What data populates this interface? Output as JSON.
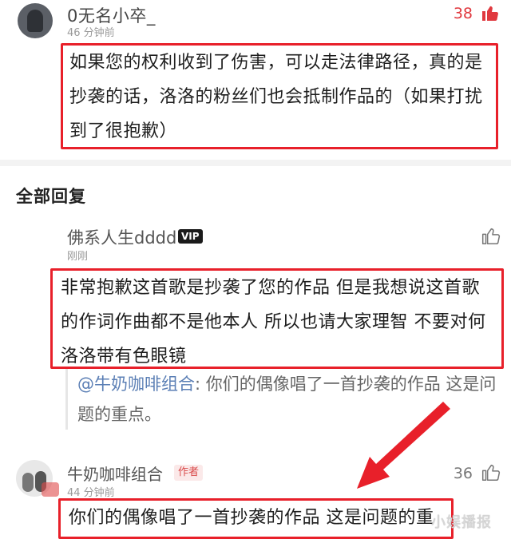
{
  "comment1": {
    "username": "0无名小卒_",
    "time": "46 分钟前",
    "likes": "38",
    "text": "如果您的权利收到了伤害，可以走法律路径，真的是抄袭的话，洛洛的粉丝们也会抵制作品的（如果打扰到了很抱歉）"
  },
  "section": {
    "title": "全部回复"
  },
  "comment2": {
    "username": "佛系人生dddd",
    "badge": "VIP",
    "time": "刚刚",
    "text": "非常抱歉这首歌是抄袭了您的作品 但是我想说这首歌的作词作曲都不是他本人 所以也请大家理智 不要对何洛洛带有色眼镜"
  },
  "quote": {
    "mention": "@牛奶咖啡组合",
    "text": ": 你们的偶像唱了一首抄袭的作品 这是问题的重点。"
  },
  "comment3": {
    "username": "牛奶咖啡组合",
    "badge": "作者",
    "time": "44 分钟前",
    "likes": "36",
    "text": "你们的偶像唱了一首抄袭的作品 这是问题的重点。"
  },
  "watermark": "小娱播报",
  "colors": {
    "highlight": "#e8202a",
    "like_red": "#e0383e",
    "mention": "#5b7fb5"
  }
}
